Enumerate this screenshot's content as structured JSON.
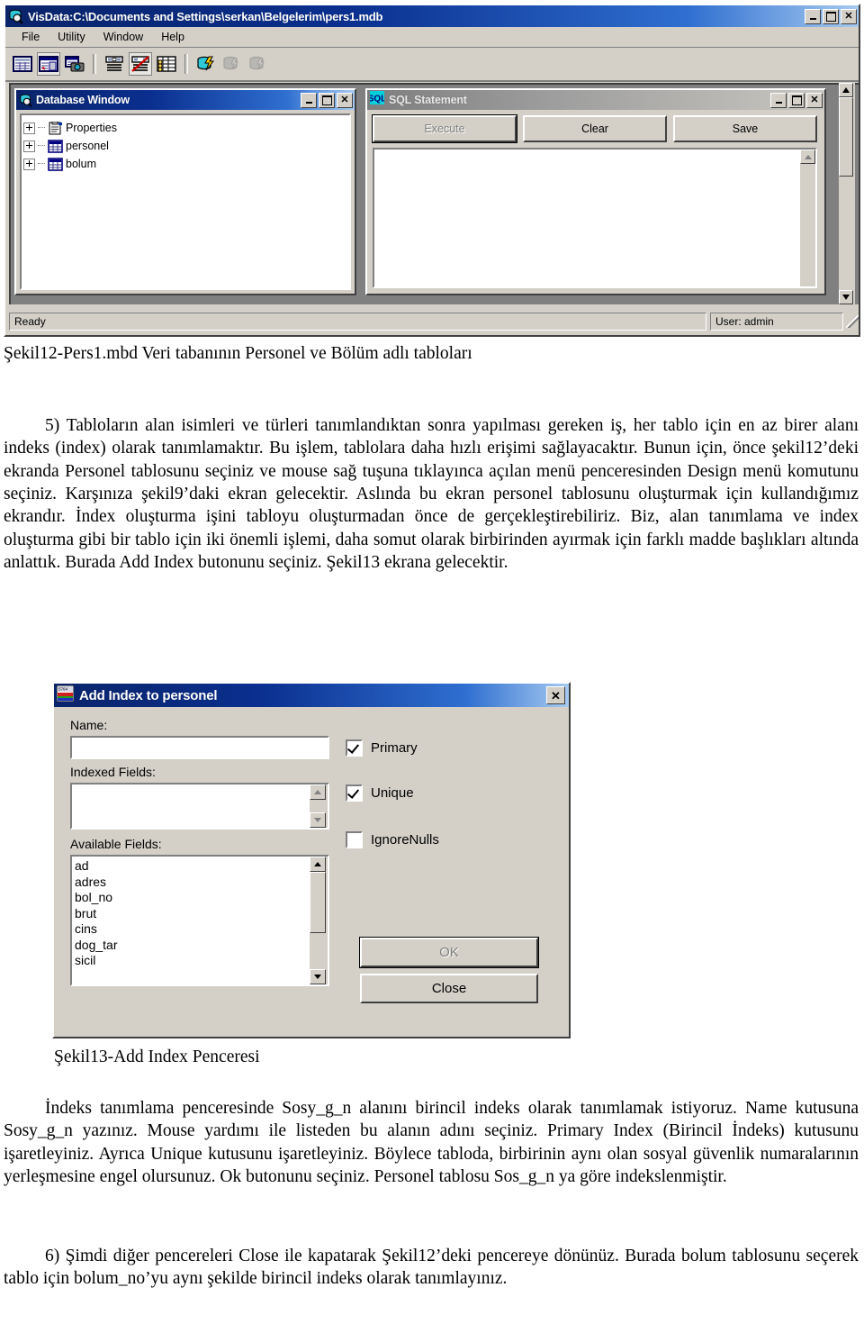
{
  "app_window": {
    "title": "VisData:C:\\Documents and Settings\\serkan\\Belgelerim\\pers1.mdb",
    "title_icon": "visdata-database-icon",
    "controls": {
      "minimize": "_",
      "maximize": "□",
      "close": "✕"
    },
    "menu": [
      {
        "label": "File"
      },
      {
        "label": "Utility"
      },
      {
        "label": "Window"
      },
      {
        "label": "Help"
      }
    ],
    "toolbar": [
      {
        "name": "table-grid-icon",
        "selected": false,
        "disabled": false
      },
      {
        "name": "table-properties-icon",
        "selected": true,
        "disabled": false
      },
      {
        "name": "table-snapshot-icon",
        "selected": false,
        "disabled": false
      },
      {
        "name": "data-control-form-icon",
        "selected": false,
        "disabled": false
      },
      {
        "name": "no-data-control-icon",
        "selected": true,
        "disabled": false
      },
      {
        "name": "grid-datasheet-icon",
        "selected": false,
        "disabled": false
      },
      {
        "name": "transaction-begin-icon",
        "selected": false,
        "disabled": false
      },
      {
        "name": "transaction-rollback-icon",
        "selected": false,
        "disabled": true
      },
      {
        "name": "transaction-commit-icon",
        "selected": false,
        "disabled": true
      }
    ],
    "status": {
      "message": "Ready",
      "user": "User: admin"
    }
  },
  "database_window": {
    "title": "Database Window",
    "title_icon": "visdata-database-icon",
    "controls": {
      "minimize": "_",
      "maximize": "□",
      "close": "✕"
    },
    "tree": [
      {
        "label": "Properties",
        "icon": "properties-list-icon",
        "expandable": true
      },
      {
        "label": "personel",
        "icon": "table-icon",
        "expandable": true
      },
      {
        "label": "bolum",
        "icon": "table-icon",
        "expandable": true
      }
    ]
  },
  "sql_window": {
    "title": "SQL Statement",
    "title_icon": "sql-icon",
    "controls": {
      "minimize": "_",
      "maximize": "□",
      "close": "✕"
    },
    "buttons": [
      {
        "label": "Execute",
        "accel": "E",
        "disabled": true,
        "default": true
      },
      {
        "label": "Clear",
        "accel": "C",
        "disabled": false,
        "default": false
      },
      {
        "label": "Save",
        "accel": "S",
        "disabled": false,
        "default": false
      }
    ],
    "editor_value": ""
  },
  "figure12_caption": "Şekil12-Pers1.mbd Veri tabanının Personel ve Bölüm adlı tabloları",
  "paragraph_5": "5) Tabloların alan isimleri ve türleri tanımlandıktan sonra yapılması gereken iş, her tablo için en az birer alanı indeks (index) olarak tanımlamaktır. Bu işlem, tablolara daha hızlı erişimi sağlayacaktır. Bunun için, önce şekil12’deki ekranda Personel tablosunu seçiniz ve mouse sağ tuşuna tıklayınca açılan menü penceresinden Design menü komutunu seçiniz. Karşınıza şekil9’daki ekran gelecektir. Aslında bu ekran personel tablosunu oluşturmak için kullandığımız ekrandır. İndex oluşturma işini tabloyu oluşturmadan önce de gerçekleştirebiliriz. Biz, alan tanımlama ve index oluşturma gibi bir tablo için iki önemli işlemi, daha somut olarak birbirinden ayırmak için farklı madde başlıkları altında anlattık. Burada Add Index butonunu seçiniz. Şekil13 ekrana gelecektir.",
  "add_index_dialog": {
    "title": "Add Index to personel",
    "title_icon": "index-dialog-icon",
    "close_label": "✕",
    "name_label": "Name:",
    "name_value": "",
    "indexed_fields_label": "Indexed Fields:",
    "indexed_fields": [],
    "available_fields_label": "Available Fields:",
    "available_fields": [
      "ad",
      "adres",
      "bol_no",
      "brut",
      "cins",
      "dog_tar",
      "sicil"
    ],
    "checkboxes": [
      {
        "label": "Primary",
        "checked": true
      },
      {
        "label": "Unique",
        "checked": true
      },
      {
        "label": "IgnoreNulls",
        "checked": false
      }
    ],
    "ok_label": "OK",
    "ok_accel": "O",
    "ok_disabled": true,
    "close_button_label": "Close",
    "close_accel": "C"
  },
  "figure13_caption": "Şekil13-Add Index Penceresi",
  "paragraph_index": "İndeks tanımlama penceresinde Sosy_g_n alanını birincil indeks olarak tanımlamak istiyoruz. Name kutusuna Sosy_g_n yazınız. Mouse yardımı ile listeden bu alanın adını seçiniz. Primary Index (Birincil İndeks) kutusunu işaretleyiniz. Ayrıca Unique kutusunu işaretleyiniz. Böylece tabloda, birbirinin aynı olan sosyal güvenlik numaralarının yerleşmesine engel olursunuz. Ok butonunu seçiniz. Personel tablosu Sos_g_n ya göre indekslenmiştir.",
  "paragraph_6": "6) Şimdi diğer pencereleri Close ile kapatarak Şekil12’deki pencereye dönünüz. Burada bolum tablosunu seçerek tablo için bolum_no’yu aynı şekilde birincil indeks olarak tanımlayınız.",
  "colors": {
    "titlebar_active": "#0a246a",
    "titlebar_inactive": "#808080",
    "face": "#d4d0c8",
    "window": "#ffffff",
    "disabled_text": "#808080"
  }
}
